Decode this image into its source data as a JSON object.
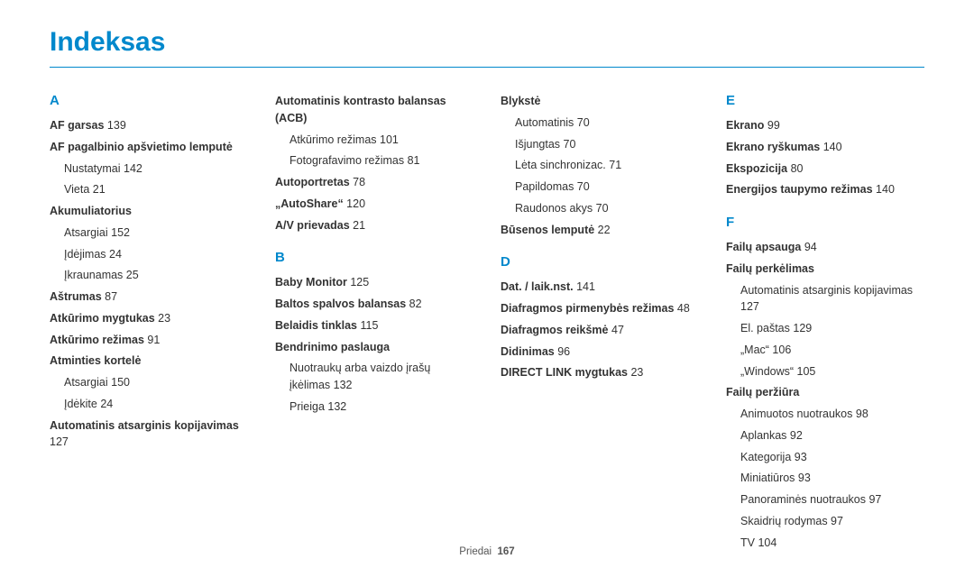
{
  "title": "Indeksas",
  "footer": {
    "label": "Priedai",
    "page": "167"
  },
  "columns": [
    {
      "blocks": [
        {
          "type": "letter",
          "text": "A"
        },
        {
          "type": "main",
          "label": "AF garsas",
          "page": "139"
        },
        {
          "type": "main",
          "label": "AF pagalbinio apšvietimo lemputė"
        },
        {
          "type": "sub",
          "label": "Nustatymai",
          "page": "142"
        },
        {
          "type": "sub",
          "label": "Vieta",
          "page": "21"
        },
        {
          "type": "main",
          "label": "Akumuliatorius"
        },
        {
          "type": "sub",
          "label": "Atsargiai",
          "page": "152"
        },
        {
          "type": "sub",
          "label": "Įdėjimas",
          "page": "24"
        },
        {
          "type": "sub",
          "label": "Įkraunamas",
          "page": "25"
        },
        {
          "type": "main",
          "label": "Aštrumas",
          "page": "87"
        },
        {
          "type": "main",
          "label": "Atkūrimo mygtukas",
          "page": "23"
        },
        {
          "type": "main",
          "label": "Atkūrimo režimas",
          "page": "91"
        },
        {
          "type": "main",
          "label": "Atminties kortelė"
        },
        {
          "type": "sub",
          "label": "Atsargiai",
          "page": "150"
        },
        {
          "type": "sub",
          "label": "Įdėkite",
          "page": "24"
        },
        {
          "type": "main",
          "label": "Automatinis atsarginis kopijavimas",
          "page": "127"
        }
      ]
    },
    {
      "blocks": [
        {
          "type": "main",
          "label": "Automatinis kontrasto balansas (ACB)"
        },
        {
          "type": "sub",
          "label": "Atkūrimo režimas",
          "page": "101"
        },
        {
          "type": "sub",
          "label": "Fotografavimo režimas",
          "page": "81"
        },
        {
          "type": "main",
          "label": "Autoportretas",
          "page": "78"
        },
        {
          "type": "main",
          "label": "„AutoShare“",
          "page": "120"
        },
        {
          "type": "main",
          "label": "A/V prievadas",
          "page": "21"
        },
        {
          "type": "letter",
          "text": "B",
          "mt": true
        },
        {
          "type": "main",
          "label": "Baby Monitor",
          "page": "125"
        },
        {
          "type": "main",
          "label": "Baltos spalvos balansas",
          "page": "82"
        },
        {
          "type": "main",
          "label": "Belaidis tinklas",
          "page": "115"
        },
        {
          "type": "main",
          "label": "Bendrinimo paslauga"
        },
        {
          "type": "sub",
          "label": "Nuotraukų arba vaizdo įrašų įkėlimas",
          "page": "132"
        },
        {
          "type": "sub",
          "label": "Prieiga",
          "page": "132"
        }
      ]
    },
    {
      "blocks": [
        {
          "type": "main",
          "label": "Blykstė"
        },
        {
          "type": "sub",
          "label": "Automatinis",
          "page": "70"
        },
        {
          "type": "sub",
          "label": "Išjungtas",
          "page": "70"
        },
        {
          "type": "sub",
          "label": "Lėta sinchronizac.",
          "page": "71"
        },
        {
          "type": "sub",
          "label": "Papildomas",
          "page": "70"
        },
        {
          "type": "sub",
          "label": "Raudonos akys",
          "page": "70"
        },
        {
          "type": "main",
          "label": "Būsenos lemputė",
          "page": "22"
        },
        {
          "type": "letter",
          "text": "D",
          "mt": true
        },
        {
          "type": "main",
          "label": "Dat. / laik.nst.",
          "page": "141"
        },
        {
          "type": "main",
          "label": "Diafragmos pirmenybės režimas",
          "page": "48"
        },
        {
          "type": "main",
          "label": "Diafragmos reikšmė",
          "page": "47"
        },
        {
          "type": "main",
          "label": "Didinimas",
          "page": "96"
        },
        {
          "type": "main",
          "label": "DIRECT LINK mygtukas",
          "page": "23"
        }
      ]
    },
    {
      "blocks": [
        {
          "type": "letter",
          "text": "E"
        },
        {
          "type": "main",
          "label": "Ekrano",
          "page": "99"
        },
        {
          "type": "main",
          "label": "Ekrano ryškumas",
          "page": "140"
        },
        {
          "type": "main",
          "label": "Ekspozicija",
          "page": "80"
        },
        {
          "type": "main",
          "label": "Energijos taupymo režimas",
          "page": "140"
        },
        {
          "type": "letter",
          "text": "F",
          "mt": true
        },
        {
          "type": "main",
          "label": "Failų apsauga",
          "page": "94"
        },
        {
          "type": "main",
          "label": "Failų perkėlimas"
        },
        {
          "type": "sub",
          "label": "Automatinis atsarginis kopijavimas",
          "page": "127"
        },
        {
          "type": "sub",
          "label": "El. paštas",
          "page": "129"
        },
        {
          "type": "sub",
          "label": "„Mac“",
          "page": "106"
        },
        {
          "type": "sub",
          "label": "„Windows“",
          "page": "105"
        },
        {
          "type": "main",
          "label": "Failų peržiūra"
        },
        {
          "type": "sub",
          "label": "Animuotos nuotraukos",
          "page": "98"
        },
        {
          "type": "sub",
          "label": "Aplankas",
          "page": "92"
        },
        {
          "type": "sub",
          "label": "Kategorija",
          "page": "93"
        },
        {
          "type": "sub",
          "label": "Miniatiūros",
          "page": "93"
        },
        {
          "type": "sub",
          "label": "Panoraminės nuotraukos",
          "page": "97"
        },
        {
          "type": "sub",
          "label": "Skaidrių rodymas",
          "page": "97"
        },
        {
          "type": "sub",
          "label": "TV",
          "page": "104"
        }
      ]
    }
  ]
}
